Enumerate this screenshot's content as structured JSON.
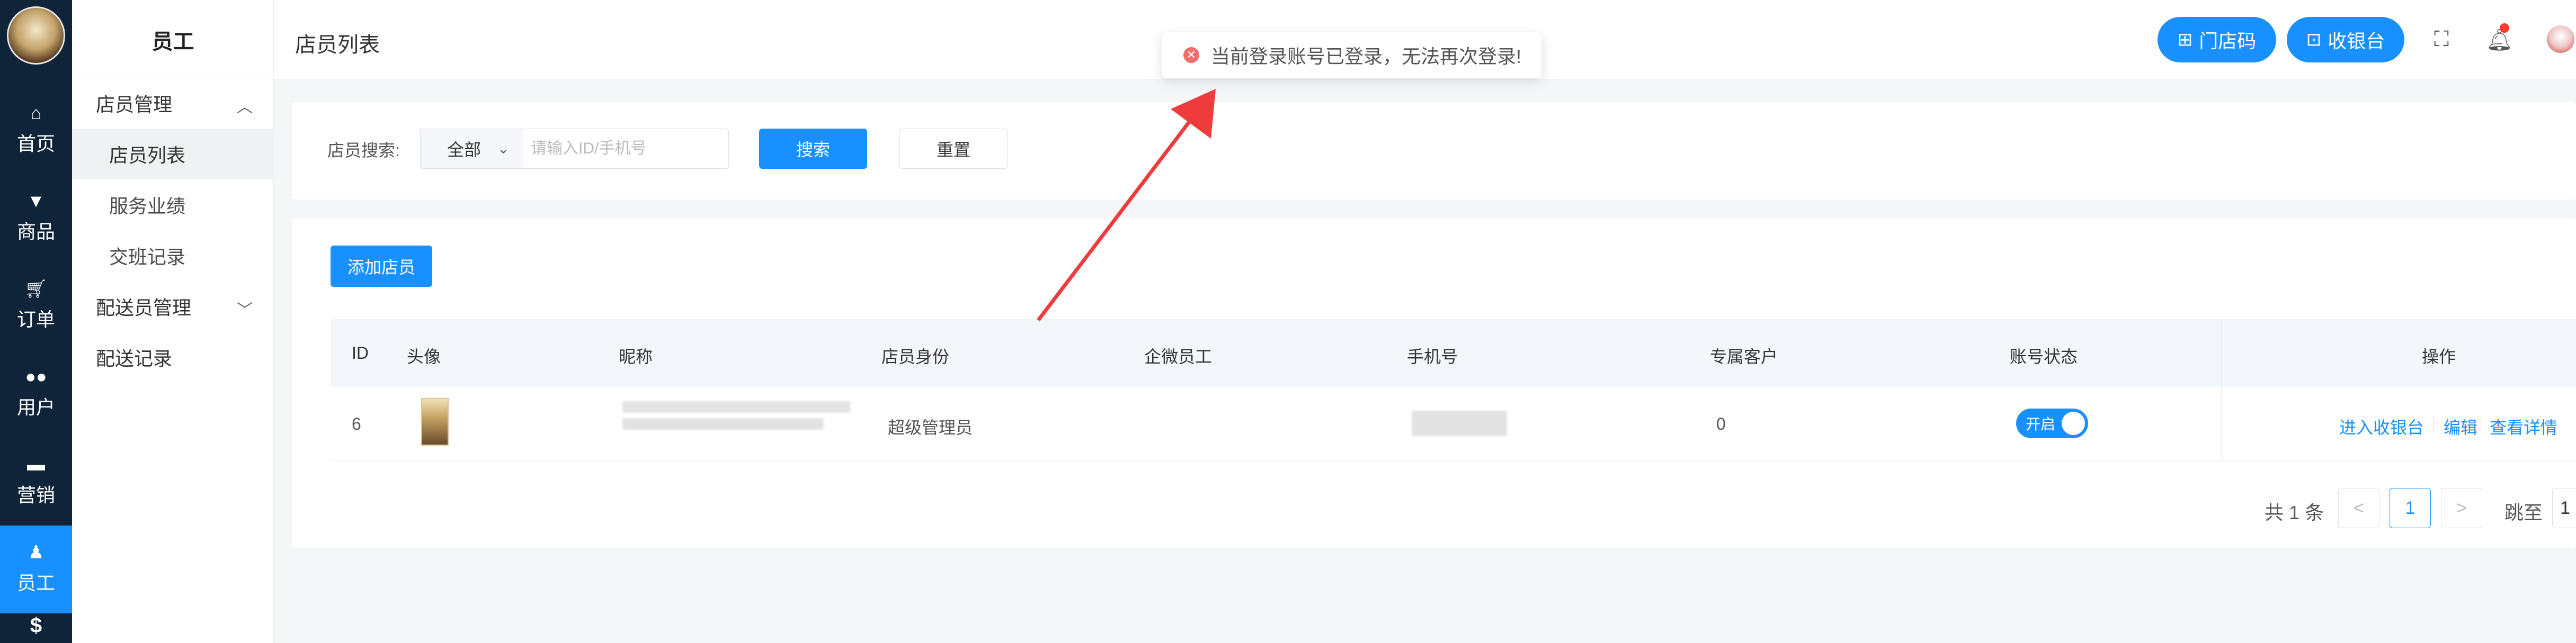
{
  "rail": {
    "items": [
      {
        "label": "首页",
        "icon": "home-icon"
      },
      {
        "label": "商品",
        "icon": "basket-icon"
      },
      {
        "label": "订单",
        "icon": "cart-icon"
      },
      {
        "label": "用户",
        "icon": "users-icon"
      },
      {
        "label": "营销",
        "icon": "briefcase-icon"
      },
      {
        "label": "员工",
        "icon": "person-icon"
      },
      {
        "label": "",
        "icon": "dollar-icon"
      }
    ]
  },
  "submenu": {
    "title": "员工",
    "group1": "店员管理",
    "items": [
      "店员列表",
      "服务业绩",
      "交班记录"
    ],
    "group2": "配送员管理",
    "group2_item": "配送记录"
  },
  "header": {
    "title": "店员列表",
    "store_code": "门店码",
    "cashier": "收银台"
  },
  "toast": {
    "message": "当前登录账号已登录，无法再次登录!"
  },
  "search": {
    "label": "店员搜索:",
    "select_value": "全部",
    "placeholder": "请输入ID/手机号",
    "search_btn": "搜索",
    "reset_btn": "重置"
  },
  "add_btn": "添加店员",
  "table": {
    "headers": [
      "ID",
      "头像",
      "昵称",
      "店员身份",
      "企微员工",
      "手机号",
      "专属客户",
      "账号状态",
      "操作"
    ],
    "row": {
      "id": "6",
      "role": "超级管理员",
      "customers": "0",
      "status": "开启",
      "ops": [
        "进入收银台",
        "编辑",
        "查看详情"
      ]
    }
  },
  "pagination": {
    "total": "共 1 条",
    "prev": "<",
    "current": "1",
    "next": ">",
    "jump": "跳至",
    "jump_value": "1"
  },
  "colors": {
    "primary": "#1890ff",
    "rail_bg": "#0f2438",
    "error": "#f56c6c",
    "annotation": "#ee3b3b"
  }
}
